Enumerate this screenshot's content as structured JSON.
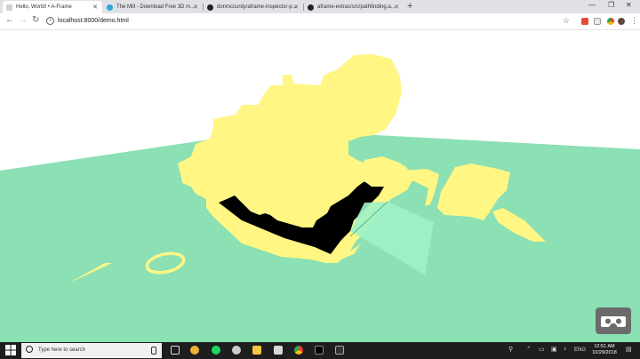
{
  "browser": {
    "tabs": [
      {
        "title": "Hello, World! • A-Frame",
        "active": true
      },
      {
        "title": "The Mill - Download Free 3D m...",
        "active": false
      },
      {
        "title": "donmccurdy/aframe-inspector-p...",
        "active": false
      },
      {
        "title": "aframe-extras/src/pathfinding.a...",
        "active": false
      }
    ],
    "url": "localhost:8000/demo.html"
  },
  "colors": {
    "ground": "#8be0b4",
    "building": "#fff684",
    "shadow": "#000000",
    "glass": "#9ef2c8",
    "vr_button": "#6b6b6b"
  },
  "vr_button_icon": "vr-headset-icon",
  "taskbar": {
    "search_placeholder": "Type here to search",
    "language": "ENG",
    "time": "12:51 AM",
    "date": "10/29/2018"
  }
}
